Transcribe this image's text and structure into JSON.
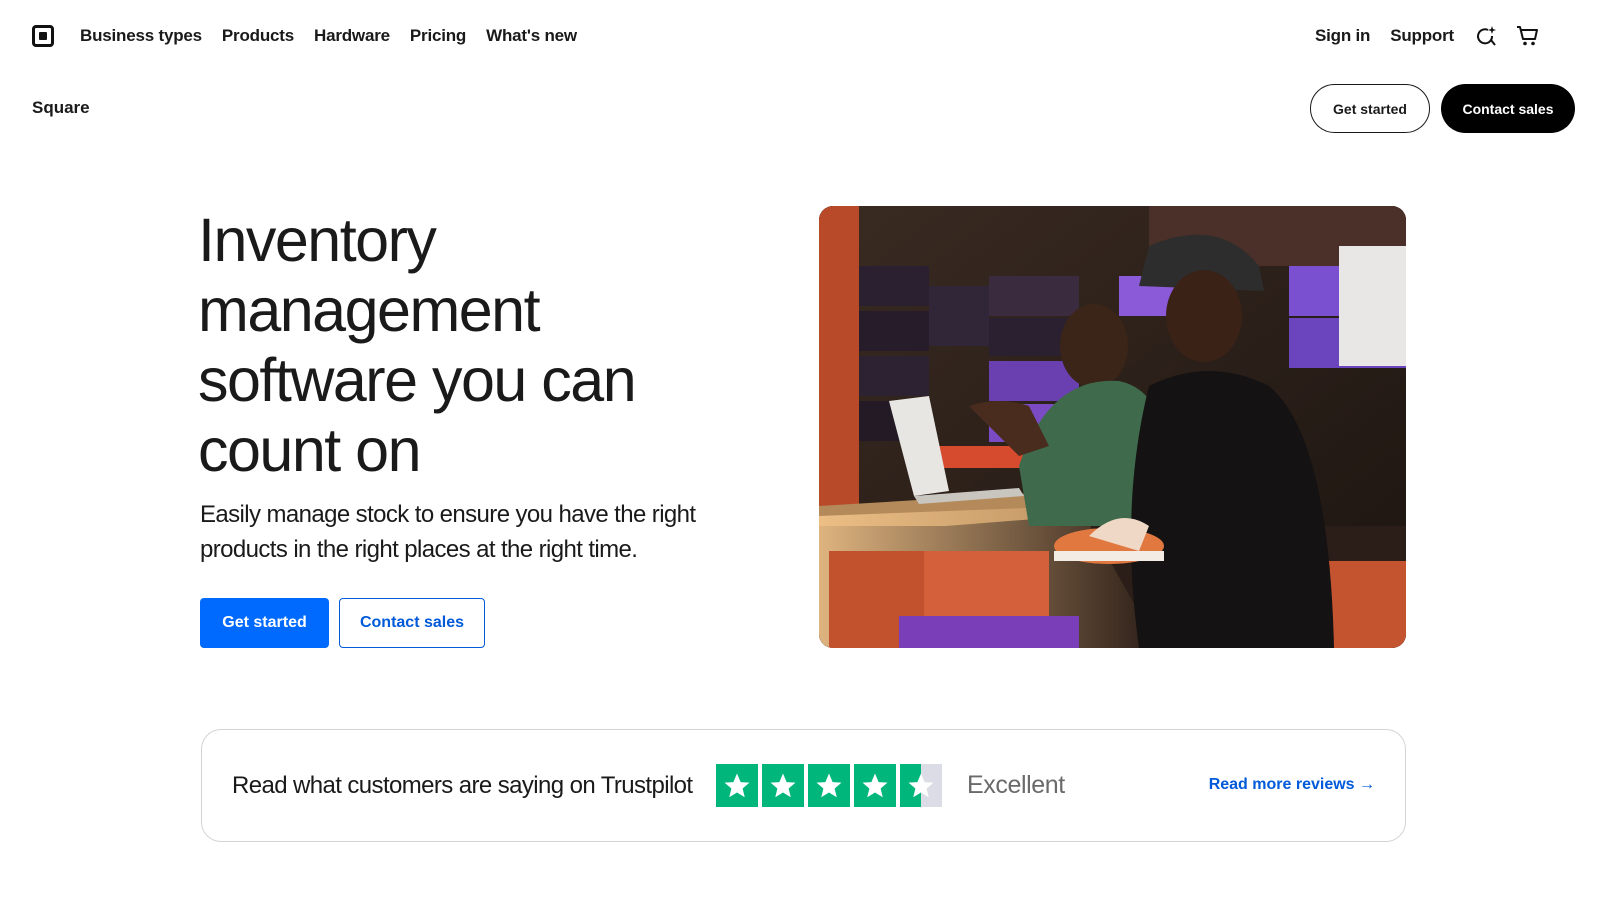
{
  "nav": {
    "logo_name": "square-logo-icon",
    "links": [
      "Business types",
      "Products",
      "Hardware",
      "Pricing",
      "What's new"
    ],
    "right_links": [
      "Sign in",
      "Support"
    ],
    "icons": [
      "sparkle-search-icon",
      "cart-icon"
    ]
  },
  "subheader": {
    "brand": "Square",
    "get_started": "Get started",
    "contact_sales": "Contact sales"
  },
  "hero": {
    "title": "Inventory management software you can count on",
    "subtitle": "Easily manage stock to ensure you have the right products in the right places at the right time.",
    "primary_button": "Get started",
    "secondary_button": "Contact sales"
  },
  "trustpilot": {
    "text": "Read what customers are saying on Trustpilot",
    "rating": 4.5,
    "rating_label": "Excellent",
    "link": "Read more reviews →"
  },
  "colors": {
    "accent": "#006aff",
    "link": "#005ad9",
    "trustpilot_green": "#00b67a"
  }
}
